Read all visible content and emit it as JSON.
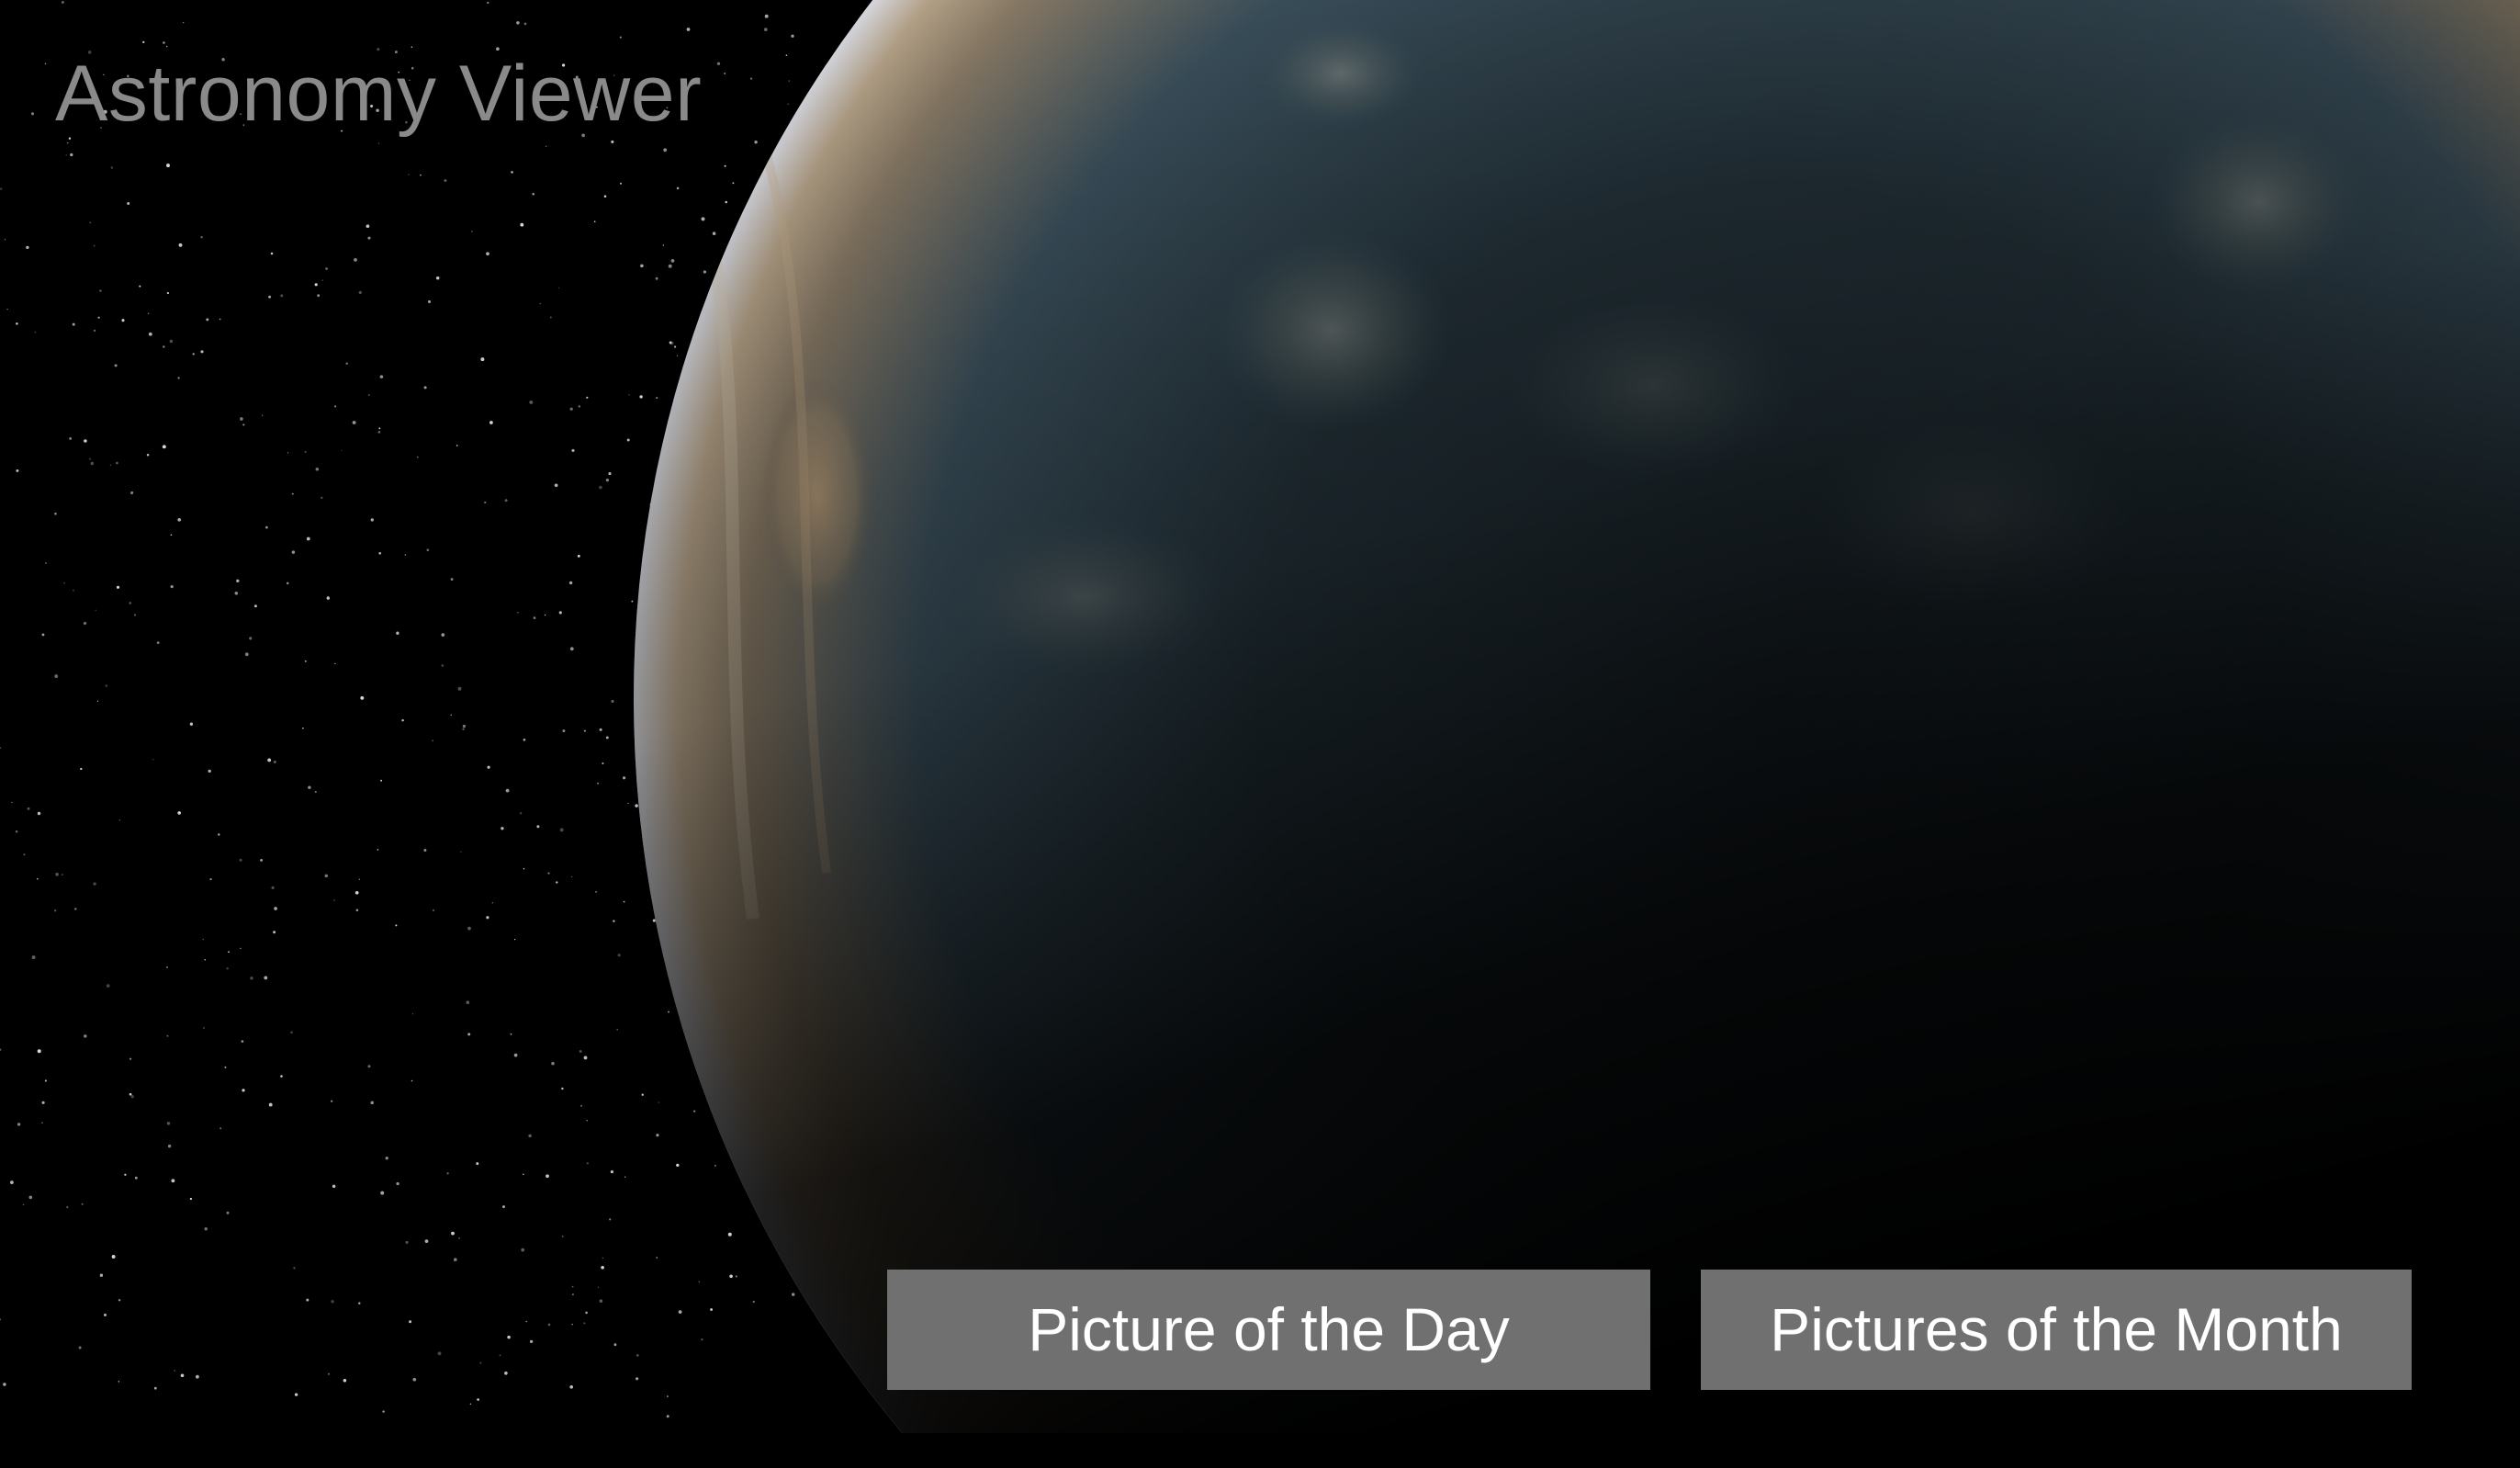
{
  "app": {
    "title": "Astronomy Viewer"
  },
  "actions": {
    "picture_of_day_label": "Picture of the Day",
    "pictures_of_month_label": "Pictures of the Month"
  },
  "colors": {
    "background": "#000000",
    "title_text": "#8a8a8a",
    "button_bg": "#707070",
    "button_text": "#ffffff",
    "planet_limb": "#c7c9d2",
    "planet_band_tan": "#b59b7a",
    "planet_body_blue": "#3c5462"
  }
}
